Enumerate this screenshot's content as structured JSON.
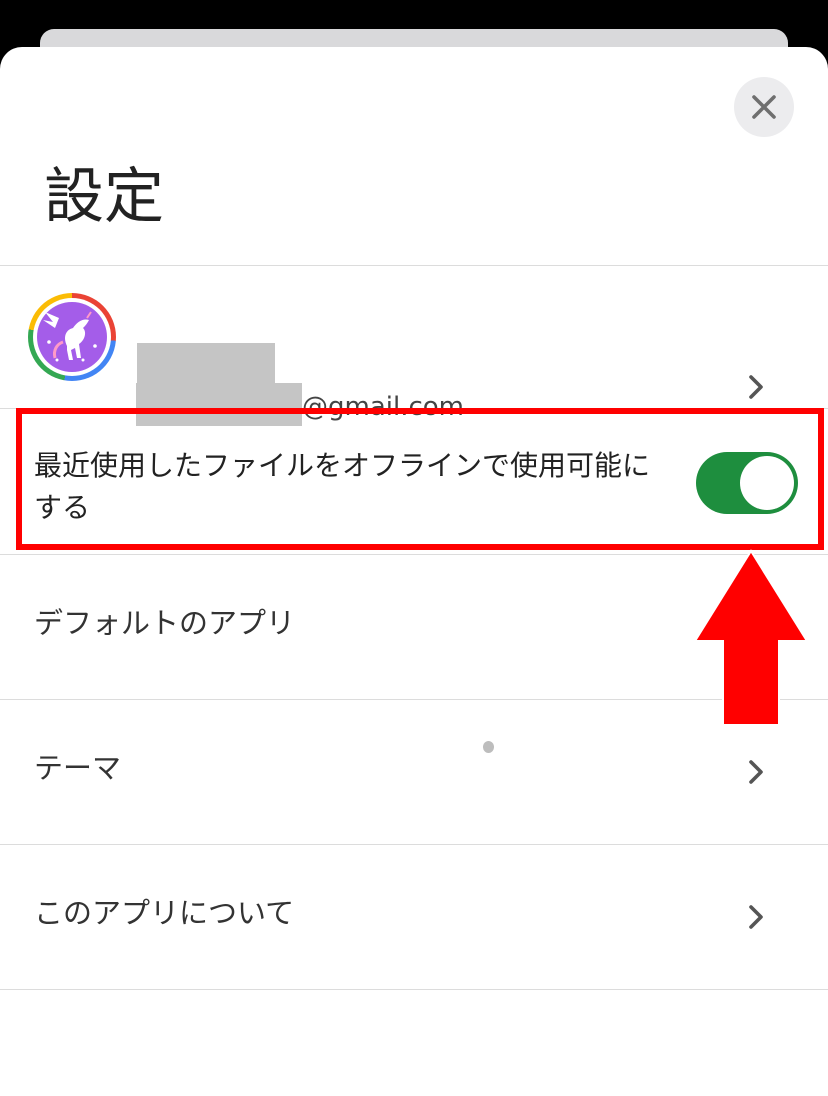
{
  "header": {
    "title": "設定",
    "close_icon": "close-icon"
  },
  "account": {
    "email_suffix": "@gmail.com",
    "avatar_icon": "pegasus-avatar-icon",
    "chevron_icon": "chevron-right-icon"
  },
  "settings": {
    "offline_label": "最近使用したファイルをオフラインで使用可能にする",
    "offline_enabled": true,
    "toggle_color": "#1e8e3e"
  },
  "menu": [
    {
      "label": "デフォルトのアプリ"
    },
    {
      "label": "テーマ"
    },
    {
      "label": "このアプリについて"
    }
  ],
  "annotations": {
    "highlight_color": "#ff0000",
    "arrow_direction": "up"
  }
}
